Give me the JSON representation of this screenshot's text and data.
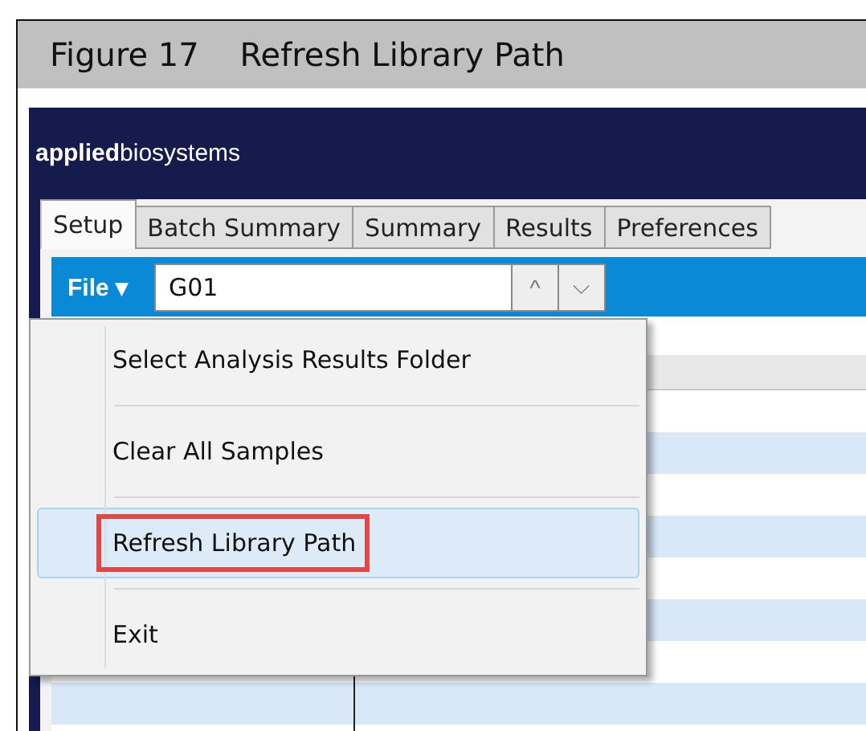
{
  "figure": {
    "title": "Figure 17    Refresh Library Path"
  },
  "app": {
    "logo": "**applied**biosystems",
    "tabs": [
      {
        "label": "Setup",
        "selected": true
      },
      {
        "label": "Batch Summary",
        "selected": false
      },
      {
        "label": "Summary",
        "selected": false
      },
      {
        "label": "Results",
        "selected": false
      },
      {
        "label": "Preferences",
        "selected": false
      }
    ],
    "toolbar": {
      "file_menu": "File ▾",
      "sample_field": {
        "value": "G01"
      },
      "previous_button": "^",
      "next_button": "⌵"
    },
    "file_menu": {
      "items": [
        {
          "label": "Select Analysis Results Folder",
          "selected": false,
          "annotated": false
        },
        {
          "label": "Clear All Samples",
          "selected": false,
          "annotated": false
        },
        {
          "label": "Refresh Library Path",
          "selected": true,
          "annotated": true
        },
        {
          "label": "Exit",
          "selected": false,
          "annotated": false
        }
      ]
    }
  }
}
